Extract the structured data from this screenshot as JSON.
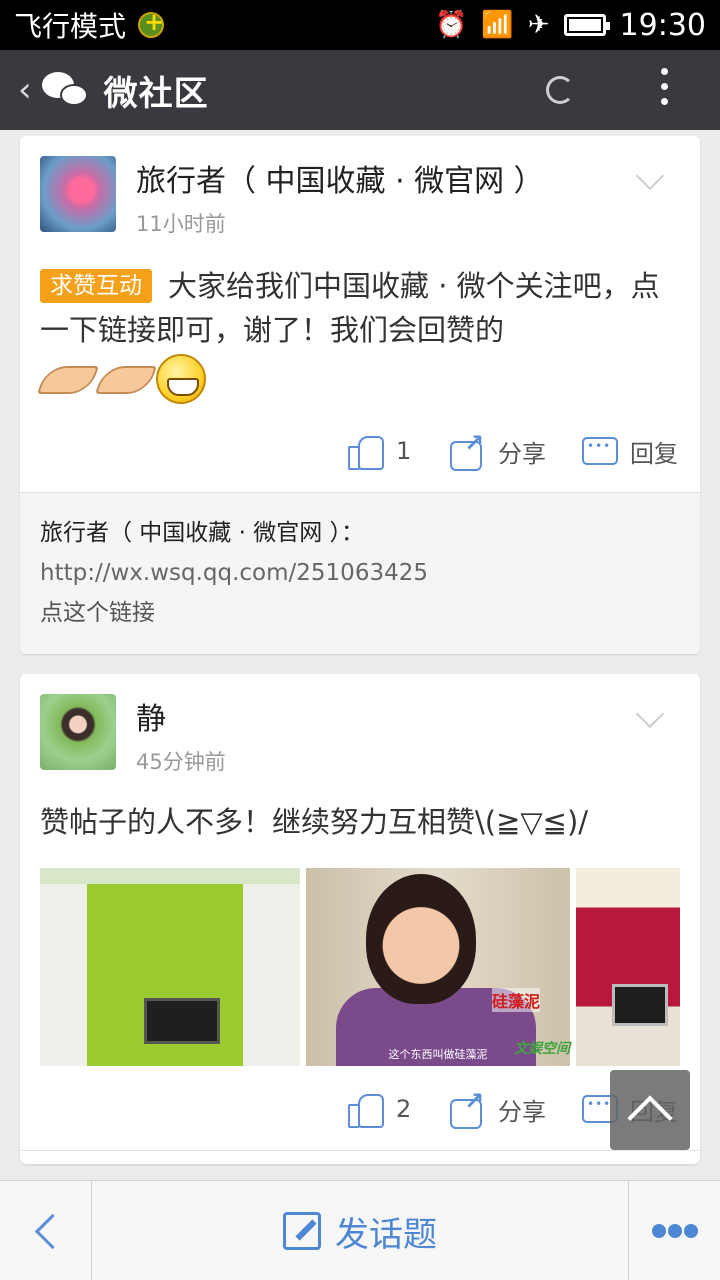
{
  "status_bar": {
    "mode_label": "飞行模式",
    "time": "19:30",
    "icons": [
      "shield-badge-icon",
      "alarm-icon",
      "wifi-icon",
      "airplane-icon",
      "battery-icon"
    ]
  },
  "header": {
    "title": "微社区",
    "icons": [
      "back-chevron-icon",
      "wechat-icon",
      "loading-spinner-icon",
      "more-vert-icon"
    ]
  },
  "posts": [
    {
      "author": "旅行者（ 中国收藏 · 微官网 ）",
      "time": "11小时前",
      "tag": "求赞互动",
      "text": "大家给我们中国收藏 · 微个关注吧，点一下链接即可，谢了！我们会回赞的",
      "emojis": [
        "hands-icon",
        "hands-icon",
        "grin-icon"
      ],
      "likes": "1",
      "share_label": "分享",
      "reply_label": "回复",
      "comment": {
        "author": "旅行者（ 中国收藏 · 微官网 ）：",
        "link": "http://wx.wsq.qq.com/251063425",
        "text": "点这个链接"
      }
    },
    {
      "author": "静",
      "time": "45分钟前",
      "text": "赞帖子的人不多！继续努力互相赞\\(≧▽≦)/",
      "photo2_caption": "这个东西叫做硅藻泥",
      "photo2_tag": "硅藻泥",
      "photo2_logo": "文娱空间",
      "likes": "2",
      "share_label": "分享",
      "reply_label": "回复"
    }
  ],
  "bottom_bar": {
    "post_label": "发话题",
    "icons": [
      "back-icon",
      "edit-icon",
      "more-dots-icon"
    ]
  },
  "colors": {
    "accent": "#4e87d3",
    "tag": "#f7a11b",
    "header_bg": "#393a3f"
  }
}
